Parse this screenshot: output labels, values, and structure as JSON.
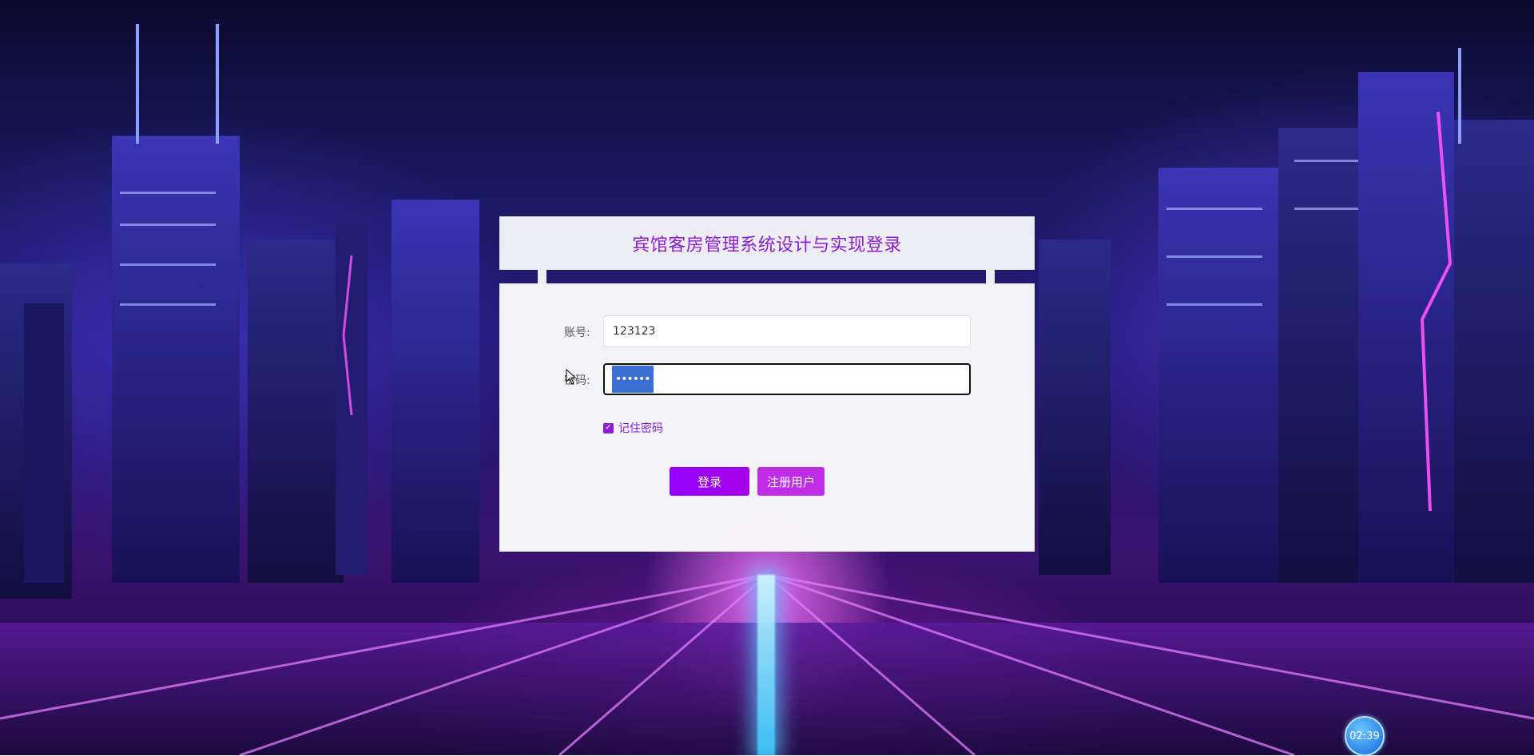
{
  "login": {
    "title": "宾馆客房管理系统设计与实现登录",
    "account_label": "账号:",
    "account_value": "123123",
    "password_label": "密码:",
    "password_mask": "••••••",
    "remember_label": "记住密码",
    "remember_checked": true,
    "login_button": "登录",
    "register_button": "注册用户"
  },
  "clock": {
    "time": "02:39"
  },
  "colors": {
    "accent": "#8a1dd8",
    "login_button": "#9300ff",
    "register_button": "#c02de6"
  }
}
